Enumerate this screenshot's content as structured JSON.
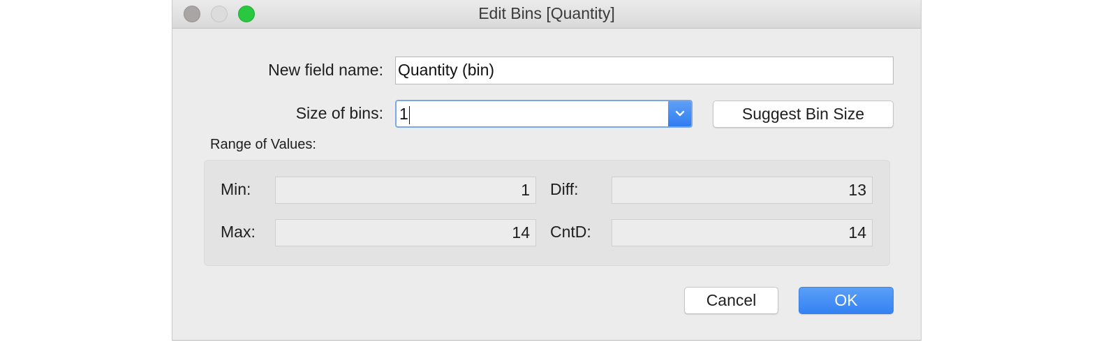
{
  "window": {
    "title": "Edit Bins [Quantity]"
  },
  "form": {
    "field_name_label": "New field name:",
    "field_name_value": "Quantity (bin)",
    "bin_size_label": "Size of bins:",
    "bin_size_value": "1",
    "suggest_label": "Suggest Bin Size"
  },
  "range": {
    "heading": "Range of Values:",
    "min_label": "Min:",
    "min_value": "1",
    "max_label": "Max:",
    "max_value": "14",
    "diff_label": "Diff:",
    "diff_value": "13",
    "cntd_label": "CntD:",
    "cntd_value": "14"
  },
  "actions": {
    "cancel_label": "Cancel",
    "ok_label": "OK"
  },
  "colors": {
    "accent": "#3482f2",
    "close": "#a9a5a5",
    "minimize": "#dcdcdc",
    "zoom": "#2ac840"
  },
  "icons": {
    "dropdown": "chevron-down-icon"
  }
}
